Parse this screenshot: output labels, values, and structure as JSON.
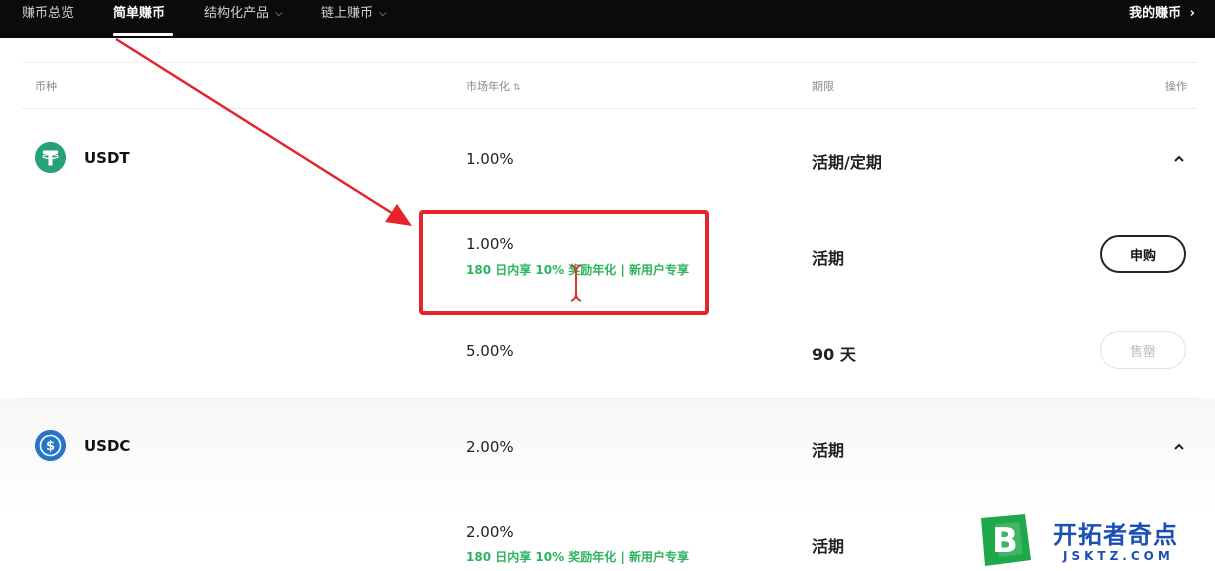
{
  "nav": {
    "items": [
      {
        "label": "赚币总览",
        "has_dropdown": false,
        "active": false
      },
      {
        "label": "简单赚币",
        "has_dropdown": false,
        "active": true
      },
      {
        "label": "结构化产品",
        "has_dropdown": true,
        "active": false
      },
      {
        "label": "链上赚币",
        "has_dropdown": true,
        "active": false
      }
    ],
    "right_link": "我的赚币",
    "right_icon": "chevron-right-icon"
  },
  "table": {
    "headers": {
      "coin": "币种",
      "apr": "市场年化",
      "term": "期限",
      "action": "操作"
    },
    "groups": [
      {
        "coin": "USDT",
        "icon": "usdt-tether-icon",
        "icon_color": "#26a17b",
        "summary_rate": "1.00%",
        "summary_term": "活期/定期",
        "expanded": true,
        "products": [
          {
            "rate": "1.00%",
            "promo": "180 日内享 10% 奖励年化 | 新用户专享",
            "term": "活期",
            "action": "申购",
            "action_enabled": true
          },
          {
            "rate": "5.00%",
            "promo": "",
            "term": "90 天",
            "action": "售罄",
            "action_enabled": false
          }
        ]
      },
      {
        "coin": "USDC",
        "icon": "usdc-dollar-icon",
        "icon_color": "#2775ca",
        "summary_rate": "2.00%",
        "summary_term": "活期",
        "expanded": true,
        "products": [
          {
            "rate": "2.00%",
            "promo": "180 日内享 10% 奖励年化 | 新用户专享",
            "term": "活期",
            "action": "",
            "action_enabled": true
          }
        ]
      }
    ]
  },
  "annotation": {
    "highlight_color": "#e4242a"
  },
  "watermark": {
    "badge_letter": "B",
    "title": "开拓者奇点",
    "subtitle": "JSKTZ.COM"
  },
  "colors": {
    "promo_green": "#2bb35e",
    "nav_bg": "#0b0b0b"
  }
}
